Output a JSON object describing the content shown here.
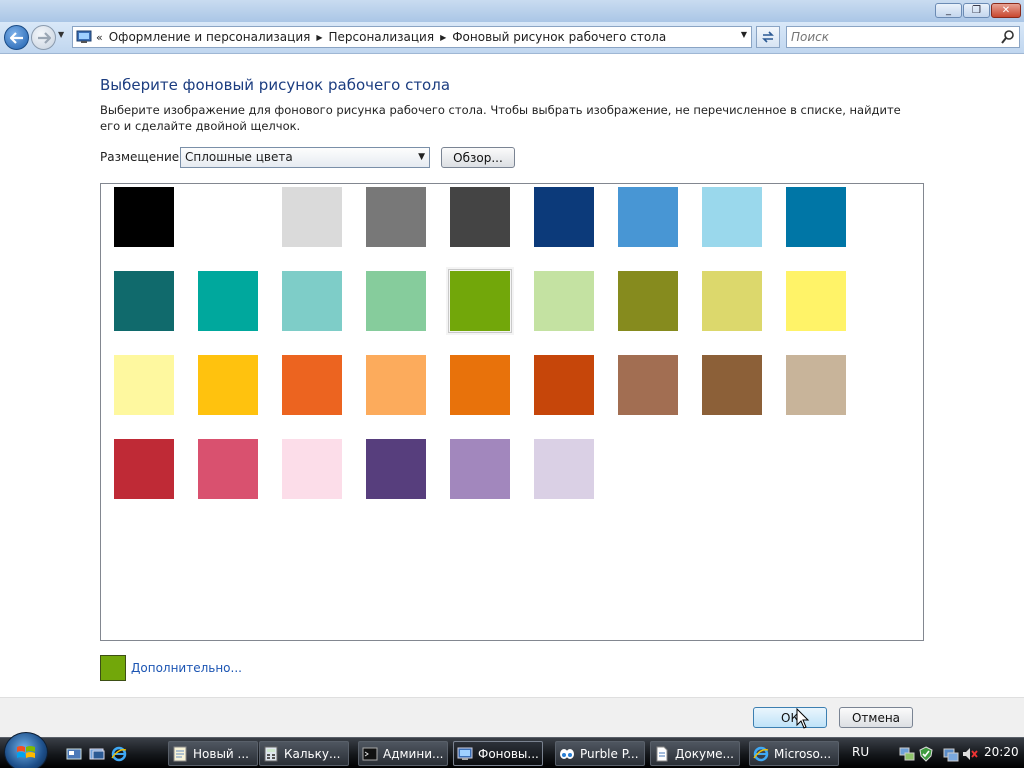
{
  "window": {
    "minimize_glyph": "_",
    "maximize_glyph": "❐",
    "close_glyph": "✕"
  },
  "navbar": {
    "breadcrumbs": [
      "Оформление и персонализация",
      "Персонализация",
      "Фоновый рисунок рабочего стола"
    ],
    "search_placeholder": "Поиск"
  },
  "content": {
    "title": "Выберите фоновый рисунок рабочего стола",
    "description": "Выберите изображение для фонового рисунка рабочего стола. Чтобы выбрать изображение, не перечисленное в списке, найдите его и сделайте двойной щелчок.",
    "placement_label": "Размещение",
    "placement_value": "Сплошные цвета",
    "browse_label": "Обзор..."
  },
  "swatches": [
    "#000000",
    "#ffffff",
    "#dadada",
    "#787878",
    "#444444",
    "#0c3a7a",
    "#4896d4",
    "#9ad8ec",
    "#0076a6",
    "#106a6c",
    "#00a89d",
    "#7ecdc8",
    "#86cc9c",
    "#72a70a",
    "#c4e2a2",
    "#868b1e",
    "#dcd86c",
    "#fff368",
    "#fef89f",
    "#ffc20e",
    "#ec6420",
    "#fcab5c",
    "#e8720b",
    "#c6460a",
    "#a26e52",
    "#8c6038",
    "#c8b49a",
    "#bf2a36",
    "#d9516f",
    "#fcdde9",
    "#573e7d",
    "#a287bd",
    "#dad0e5"
  ],
  "selected_swatch_index": 13,
  "current_color": "#72a70a",
  "advanced_link": "Дополнительно...",
  "footer": {
    "ok_label": "ОК",
    "cancel_label": "Отмена"
  },
  "taskbar": {
    "tasks": [
      {
        "label": "Новый ...",
        "icon": "notepad-icon",
        "active": false
      },
      {
        "label": "Кальку...",
        "icon": "calculator-icon",
        "active": false
      },
      {
        "label": "Админи...",
        "icon": "cmd-icon",
        "active": false
      },
      {
        "label": "Фоновы...",
        "icon": "control-panel-icon",
        "active": true
      },
      {
        "label": "Purble P...",
        "icon": "purble-icon",
        "active": false
      },
      {
        "label": "Докуме...",
        "icon": "document-icon",
        "active": false
      },
      {
        "label": "Microso...",
        "icon": "ie-icon",
        "active": false
      }
    ],
    "language": "RU",
    "clock": "20:20"
  }
}
